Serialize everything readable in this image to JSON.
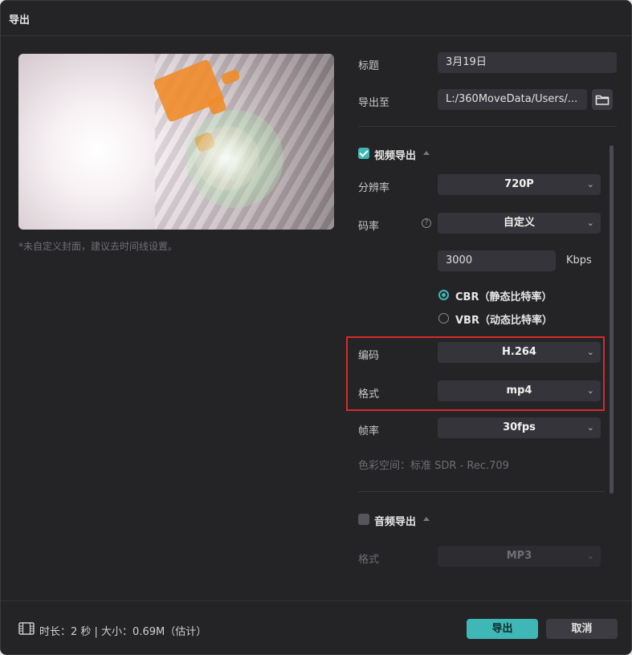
{
  "dialog": {
    "title": "导出"
  },
  "preview": {
    "cover_note": "*未自定义封面，建议去时间线设置。"
  },
  "fields": {
    "title_label": "标题",
    "title_value": "3月19日",
    "export_to_label": "导出至",
    "export_to_value": "L:/360MoveData/Users/...",
    "folder_icon": "folder-icon"
  },
  "video": {
    "section_label": "视频导出",
    "checked": true,
    "resolution_label": "分辨率",
    "resolution_value": "720P",
    "bitrate_label": "码率",
    "bitrate_help_glyph": "?",
    "bitrate_mode_value": "自定义",
    "bitrate_number": "3000",
    "bitrate_unit": "Kbps",
    "cbr_label": "CBR（静态比特率）",
    "vbr_label": "VBR（动态比特率）",
    "cbr_selected": true,
    "codec_label": "编码",
    "codec_value": "H.264",
    "format_label": "格式",
    "format_value": "mp4",
    "framerate_label": "帧率",
    "framerate_value": "30fps",
    "colorspace_text": "色彩空间：标准 SDR - Rec.709"
  },
  "audio": {
    "section_label": "音频导出",
    "checked": false,
    "format_label": "格式",
    "format_value": "MP3"
  },
  "footer": {
    "info_text": "时长：2 秒 | 大小：0.69M（估计）",
    "export_button": "导出",
    "cancel_button": "取消"
  },
  "colors": {
    "accent": "#3fb7b6",
    "highlight_border": "#d52b2b",
    "background": "#242427"
  }
}
